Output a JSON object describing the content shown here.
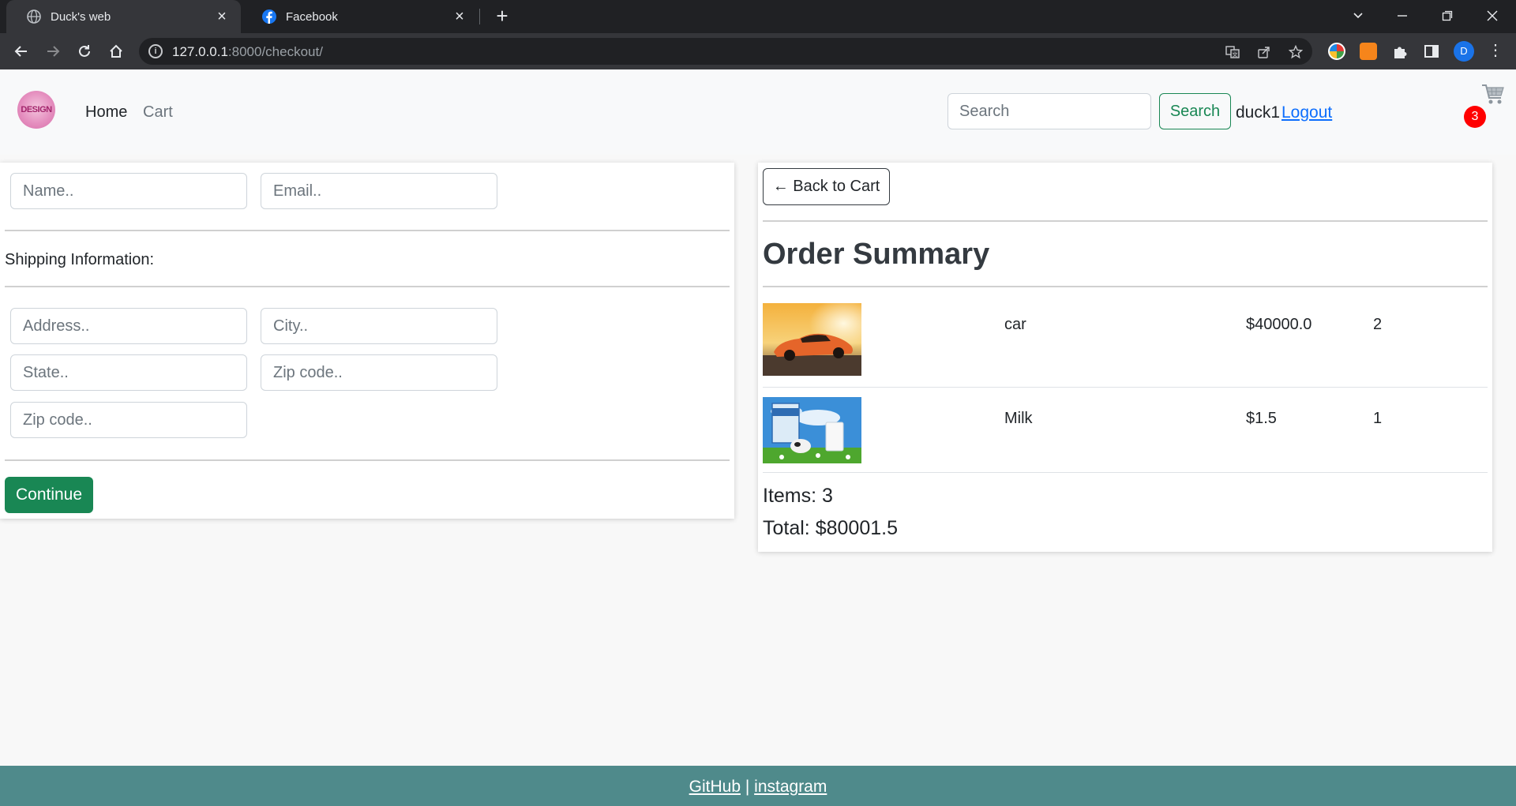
{
  "browser": {
    "tabs": [
      {
        "title": "Duck's web",
        "active": true
      },
      {
        "title": "Facebook",
        "active": false
      }
    ],
    "url_host": "127.0.0.1",
    "url_rest": ":8000/checkout/",
    "profile_initial": "D"
  },
  "navbar": {
    "logo_text": "DESIGN",
    "links": [
      {
        "label": "Home",
        "active": true
      },
      {
        "label": "Cart",
        "active": false
      }
    ],
    "search_placeholder": "Search",
    "search_button": "Search",
    "username": "duck1",
    "logout": "Logout",
    "cart_count": "3"
  },
  "checkout_form": {
    "name_placeholder": "Name..",
    "email_placeholder": "Email..",
    "shipping_label": "Shipping Information:",
    "address_placeholder": "Address..",
    "city_placeholder": "City..",
    "state_placeholder": "State..",
    "zip_placeholder": "Zip code..",
    "zip2_placeholder": "Zip code..",
    "continue_label": "Continue"
  },
  "order_summary": {
    "back_label": "← Back to Cart",
    "title": "Order Summary",
    "items": [
      {
        "name": "car",
        "price": "$40000.0",
        "quantity": "2"
      },
      {
        "name": "Milk",
        "price": "$1.5",
        "quantity": "1"
      }
    ],
    "items_text": "Items: 3",
    "total_text": "Total: $80001.5"
  },
  "footer": {
    "github": "GitHub",
    "separator": "|",
    "instagram": "instagram"
  },
  "colors": {
    "success": "#198754",
    "link": "#0d6efd",
    "badge": "#ff0000",
    "footer_bg": "#4f8a8b"
  }
}
